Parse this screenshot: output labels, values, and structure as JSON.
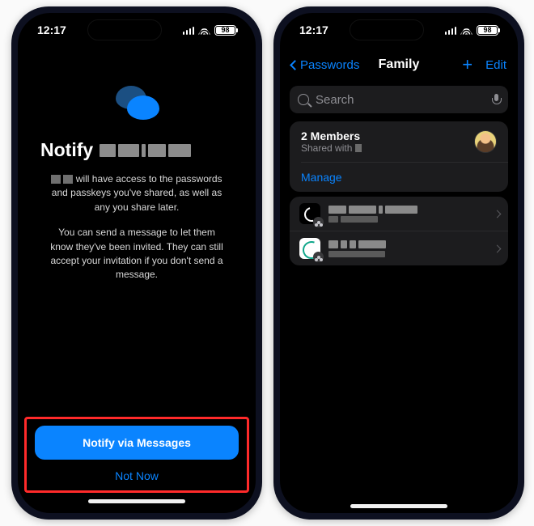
{
  "status_bar": {
    "time": "12:17",
    "battery": "98"
  },
  "left": {
    "title_prefix": "Notify",
    "para1_rest": "will have access to the passwords and passkeys you've shared, as well as any you share later.",
    "para2": "You can send a message to let them know they've been invited. They can still accept your invitation if you don't send a message.",
    "primary_btn": "Notify via Messages",
    "secondary_btn": "Not Now"
  },
  "right": {
    "back_label": "Passwords",
    "title": "Family",
    "edit": "Edit",
    "search_placeholder": "Search",
    "members_title": "2 Members",
    "shared_with": "Shared with",
    "manage": "Manage"
  }
}
